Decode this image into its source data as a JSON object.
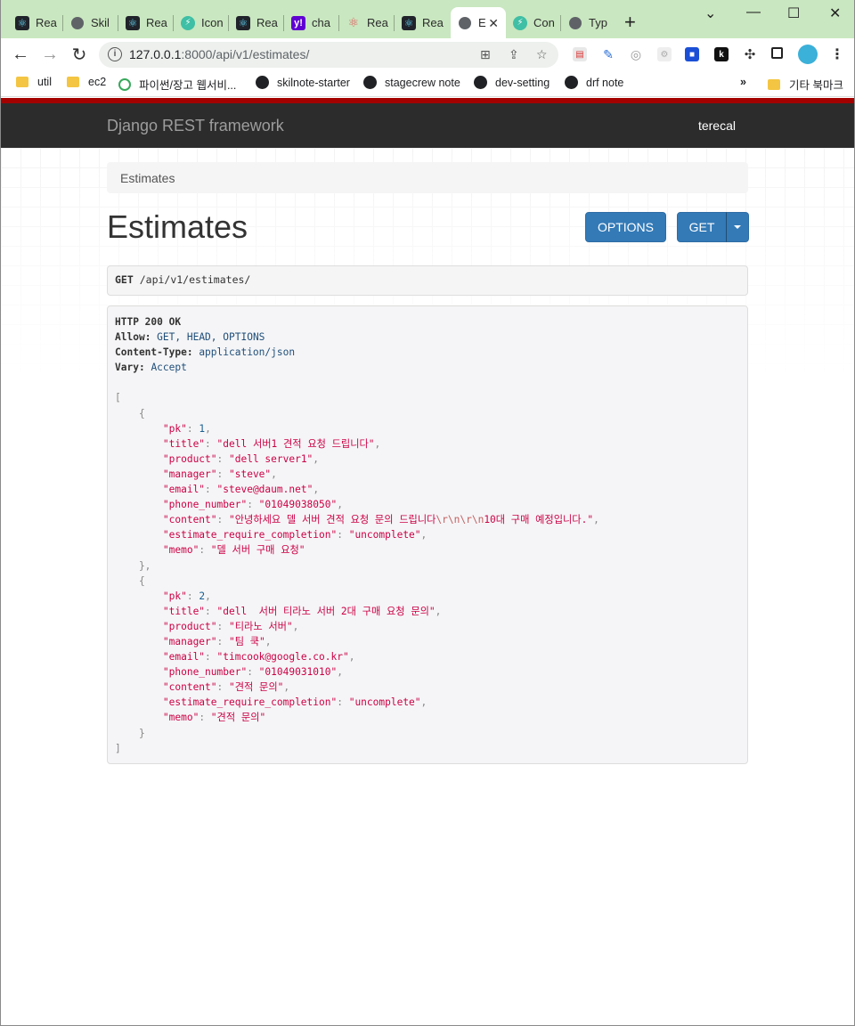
{
  "browser": {
    "tabs": [
      {
        "label": "Rea",
        "icon": "react-icon"
      },
      {
        "label": "Skil",
        "icon": "globe-icon"
      },
      {
        "label": "Rea",
        "icon": "react-icon"
      },
      {
        "label": "Icon",
        "icon": "bolt-icon"
      },
      {
        "label": "Rea",
        "icon": "react-icon"
      },
      {
        "label": "cha",
        "icon": "yahoo-icon"
      },
      {
        "label": "Rea",
        "icon": "react-red-icon"
      },
      {
        "label": "Rea",
        "icon": "react-icon"
      },
      {
        "label": "E",
        "icon": "globe-icon",
        "active": true
      },
      {
        "label": "Con",
        "icon": "bolt-icon"
      },
      {
        "label": "Typ",
        "icon": "globe-icon"
      }
    ],
    "url_host": "127.0.0.1",
    "url_rest": ":8000/api/v1/estimates/",
    "bookmarks": [
      {
        "label": "util",
        "icon": "folder-icon"
      },
      {
        "label": "ec2",
        "icon": "folder-icon"
      },
      {
        "label": "파이썬/장고 웹서비...",
        "icon": "green-circle-icon"
      },
      {
        "label": "skilnote-starter",
        "icon": "globe-icon"
      },
      {
        "label": "stagecrew note",
        "icon": "globe-icon"
      },
      {
        "label": "dev-setting",
        "icon": "globe-icon"
      },
      {
        "label": "drf note",
        "icon": "globe-icon"
      }
    ],
    "bookmarks_more": "»",
    "other_bookmarks": "기타 북마크"
  },
  "navbar": {
    "brand": "Django REST framework",
    "user": "terecal"
  },
  "breadcrumb": "Estimates",
  "page_title": "Estimates",
  "buttons": {
    "options": "OPTIONS",
    "get": "GET"
  },
  "request": {
    "method": "GET",
    "path": "/api/v1/estimates/"
  },
  "response": {
    "status": "HTTP 200 OK",
    "headers": [
      {
        "name": "Allow",
        "value": "GET, HEAD, OPTIONS"
      },
      {
        "name": "Content-Type",
        "value": "application/json"
      },
      {
        "name": "Vary",
        "value": "Accept"
      }
    ],
    "items": [
      {
        "pk": "1",
        "title": "\"dell 서버1 견적 요청 드립니다\"",
        "product": "\"dell server1\"",
        "manager": "\"steve\"",
        "email": "\"steve@daum.net\"",
        "phone_number": "\"01049038050\"",
        "content_a": "\"안녕하세요 델 서버 견적 요청 문의 드립니다",
        "content_esc": "\\r\\n\\r\\n",
        "content_b": "10대 구매 예정입니다.\"",
        "estimate_require_completion": "\"uncomplete\"",
        "memo": "\"델 서버 구매 요청\""
      },
      {
        "pk": "2",
        "title": "\"dell  서버 티라노 서버 2대 구매 요청 문의\"",
        "product": "\"티라노 서버\"",
        "manager": "\"팀 쿡\"",
        "email": "\"timcook@google.co.kr\"",
        "phone_number": "\"01049031010\"",
        "content": "\"견적 문의\"",
        "estimate_require_completion": "\"uncomplete\"",
        "memo": "\"견적 문의\""
      }
    ]
  }
}
